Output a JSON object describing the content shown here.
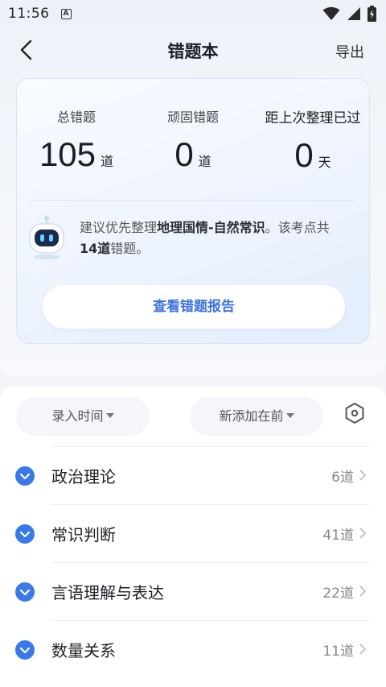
{
  "status_bar": {
    "time": "11:56",
    "notification_badge": "A",
    "icons": [
      "wifi-icon",
      "signal-icon",
      "battery-icon"
    ]
  },
  "navbar": {
    "title": "错题本",
    "export_label": "导出",
    "back_icon": "back-arrow-icon"
  },
  "summary": {
    "stats": [
      {
        "label": "总错题",
        "value": "105",
        "unit": "道"
      },
      {
        "label": "顽固错题",
        "value": "0",
        "unit": "道"
      },
      {
        "label": "距上次整理已过",
        "value": "0",
        "unit": "天"
      }
    ],
    "tip": {
      "prefix": "建议优先整理",
      "topic": "地理国情-自然常识",
      "middle": "。该考点共",
      "count": "14道",
      "suffix": "错题。"
    },
    "report_button": "查看错题报告",
    "robot_icon": "robot-assistant-icon"
  },
  "filters": {
    "time_filter": "录入时间",
    "order_filter": "新添加在前",
    "settings_icon": "hexagon-settings-icon"
  },
  "categories": [
    {
      "label": "政治理论",
      "count": "6道"
    },
    {
      "label": "常识判断",
      "count": "41道"
    },
    {
      "label": "言语理解与表达",
      "count": "22道"
    },
    {
      "label": "数量关系",
      "count": "11道"
    }
  ],
  "colors": {
    "accent": "#3e72e0",
    "check_blue": "#3a7ae8",
    "card_border": "#d7e5fb"
  }
}
